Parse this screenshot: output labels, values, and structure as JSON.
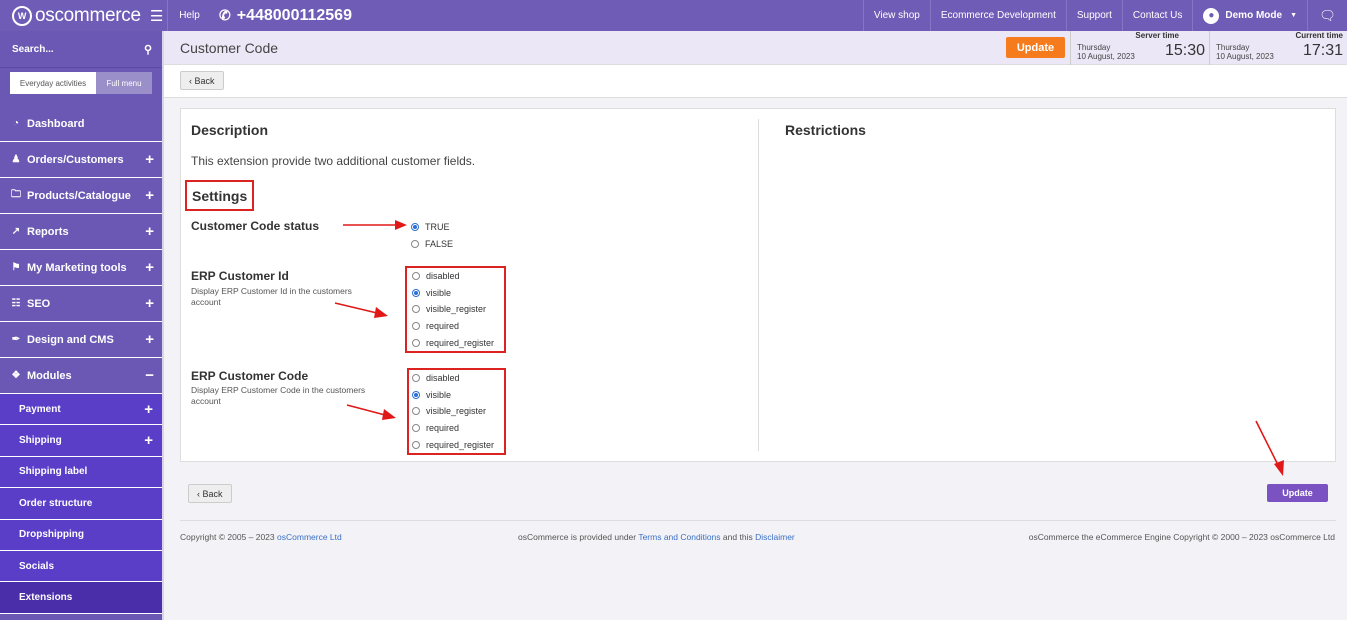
{
  "topbar": {
    "logo_text": "oscommerce",
    "help": "Help",
    "phone": "+448000112569",
    "links": [
      "View shop",
      "Ecommerce Development",
      "Support",
      "Contact Us"
    ],
    "user": "Demo Mode"
  },
  "sidebar": {
    "search_label": "Search...",
    "mode_tabs": [
      "Everyday activities",
      "Full menu"
    ],
    "items": [
      {
        "label": "Dashboard",
        "icon": "dashboard-icon",
        "expand": ""
      },
      {
        "label": "Orders/Customers",
        "icon": "users-icon",
        "expand": "+"
      },
      {
        "label": "Products/Catalogue",
        "icon": "folder-icon",
        "expand": "+"
      },
      {
        "label": "Reports",
        "icon": "chart-icon",
        "expand": "+"
      },
      {
        "label": "My Marketing tools",
        "icon": "tag-icon",
        "expand": "+"
      },
      {
        "label": "SEO",
        "icon": "sitemap-icon",
        "expand": "+"
      },
      {
        "label": "Design and CMS",
        "icon": "brush-icon",
        "expand": "+"
      },
      {
        "label": "Modules",
        "icon": "puzzle-icon",
        "expand": "−"
      }
    ],
    "subitems": [
      {
        "label": "Payment",
        "expand": "+"
      },
      {
        "label": "Shipping",
        "expand": "+"
      },
      {
        "label": "Shipping label",
        "expand": ""
      },
      {
        "label": "Order structure",
        "expand": ""
      },
      {
        "label": "Dropshipping",
        "expand": ""
      },
      {
        "label": "Socials",
        "expand": ""
      },
      {
        "label": "Extensions",
        "expand": ""
      }
    ]
  },
  "header": {
    "title": "Customer Code",
    "update_label": "Update",
    "server_time": {
      "label": "Server time",
      "day": "Thursday",
      "date": "10 August, 2023",
      "time": "15:30"
    },
    "current_time": {
      "label": "Current time",
      "day": "Thursday",
      "date": "10 August, 2023",
      "time": "17:31"
    }
  },
  "main": {
    "back_label": "Back",
    "description_heading": "Description",
    "description_text": "This extension provide two additional customer fields.",
    "restrictions_heading": "Restrictions",
    "settings_heading": "Settings",
    "fields": [
      {
        "label": "Customer Code status",
        "help": "",
        "options": [
          "TRUE",
          "FALSE"
        ],
        "selected": "TRUE"
      },
      {
        "label": "ERP Customer Id",
        "help": "Display ERP Customer Id in the customers account",
        "options": [
          "disabled",
          "visible",
          "visible_register",
          "required",
          "required_register"
        ],
        "selected": "visible"
      },
      {
        "label": "ERP Customer Code",
        "help": "Display ERP Customer Code in the customers account",
        "options": [
          "disabled",
          "visible",
          "visible_register",
          "required",
          "required_register"
        ],
        "selected": "visible"
      }
    ],
    "bottom_back_label": "Back",
    "bottom_update_label": "Update"
  },
  "footer": {
    "left_prefix": "Copyright © 2005 – 2023",
    "left_link": "osCommerce Ltd",
    "mid_prefix": "osCommerce is provided under",
    "mid_link1": "Terms and Conditions",
    "mid_and": "and this",
    "mid_link2": "Disclaimer",
    "right": "osCommerce the eCommerce Engine Copyright © 2000 – 2023 osCommerce Ltd"
  },
  "colors": {
    "brand": "#6f5cb6",
    "accent": "#f57b1c",
    "annotation": "#dd2222",
    "update_button": "#7a52c2"
  }
}
